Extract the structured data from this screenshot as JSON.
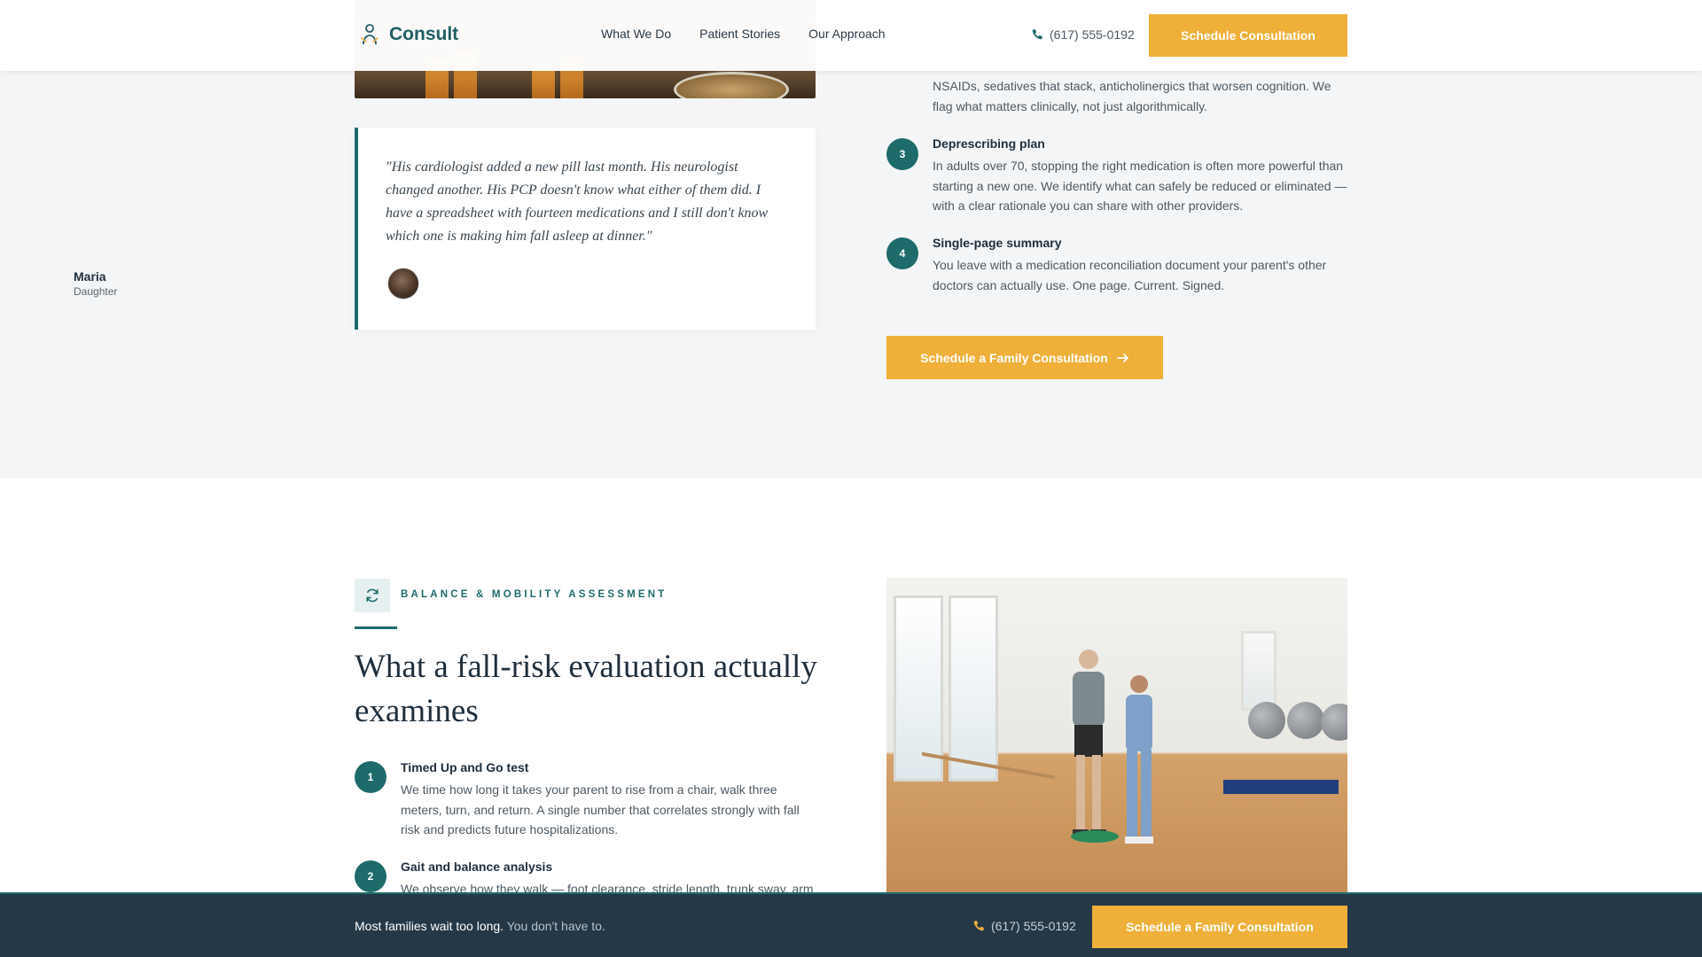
{
  "header": {
    "brand": "Consult",
    "nav": [
      "What We Do",
      "Patient Stories",
      "Our Approach"
    ],
    "phone": "(617) 555-0192",
    "cta": "Schedule Consultation"
  },
  "testimonial": {
    "quote": "\"His cardiologist added a new pill last month. His neurologist changed another. His PCP doesn't know what either of them did. I have a spreadsheet with fourteen medications and I still don't know which one is making him fall asleep at dinner.\"",
    "name": "Maria",
    "role": "Daughter"
  },
  "medication_steps": [
    {
      "number": "",
      "title": "",
      "desc": "NSAIDs, sedatives that stack, anticholinergics that worsen cognition. We flag what matters clinically, not just algorithmically."
    },
    {
      "number": "3",
      "title": "Deprescribing plan",
      "desc": "In adults over 70, stopping the right medication is often more powerful than starting a new one. We identify what can safely be reduced or eliminated — with a clear rationale you can share with other providers."
    },
    {
      "number": "4",
      "title": "Single-page summary",
      "desc": "You leave with a medication reconciliation document your parent's other doctors can actually use. One page. Current. Signed."
    }
  ],
  "family_cta": "Schedule a Family Consultation",
  "balance_section": {
    "eyebrow": "BALANCE & MOBILITY ASSESSMENT",
    "headline": "What a fall-risk evaluation actually examines",
    "steps": [
      {
        "number": "1",
        "title": "Timed Up and Go test",
        "desc": "We time how long it takes your parent to rise from a chair, walk three meters, turn, and return. A single number that correlates strongly with fall risk and predicts future hospitalizations."
      },
      {
        "number": "2",
        "title": "Gait and balance analysis",
        "desc": "We observe how they walk — foot clearance, stride length, trunk sway, arm"
      }
    ]
  },
  "sticky_bar": {
    "strong": "Most families wait too long.",
    "muted": "You don't have to.",
    "phone": "(617) 555-0192",
    "cta": "Schedule a Family Consultation"
  },
  "colors": {
    "teal": "#1e6b6b",
    "gold": "#efb03a",
    "navy": "#253847"
  }
}
